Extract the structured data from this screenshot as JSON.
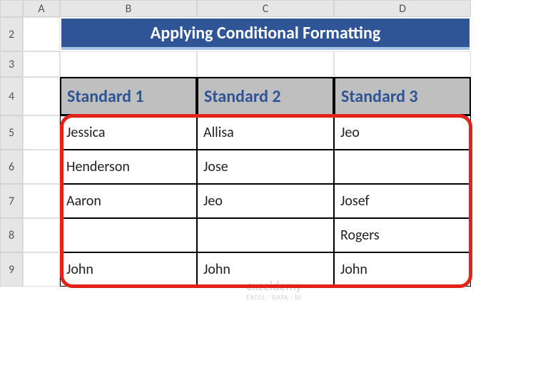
{
  "columns": [
    "A",
    "B",
    "C",
    "D"
  ],
  "rows": [
    "2",
    "3",
    "4",
    "5",
    "6",
    "7",
    "8",
    "9"
  ],
  "title": "Applying Conditional Formatting",
  "headers": {
    "b": "Standard 1",
    "c": "Standard 2",
    "d": "Standard 3"
  },
  "data": {
    "r5": {
      "b": "Jessica",
      "c": "Allisa",
      "d": "Jeo"
    },
    "r6": {
      "b": "Henderson",
      "c": "Jose",
      "d": ""
    },
    "r7": {
      "b": "Aaron",
      "c": "Jeo",
      "d": "Josef"
    },
    "r8": {
      "b": "",
      "c": "",
      "d": "Rogers"
    },
    "r9": {
      "b": "John",
      "c": "John",
      "d": "John"
    }
  },
  "watermark": {
    "brand": "exceldemy",
    "tagline": "EXCEL · DATA · BI"
  },
  "colors": {
    "titleBg": "#2f5597",
    "headerBg": "#bfbfbf",
    "outline": "#e32219"
  }
}
